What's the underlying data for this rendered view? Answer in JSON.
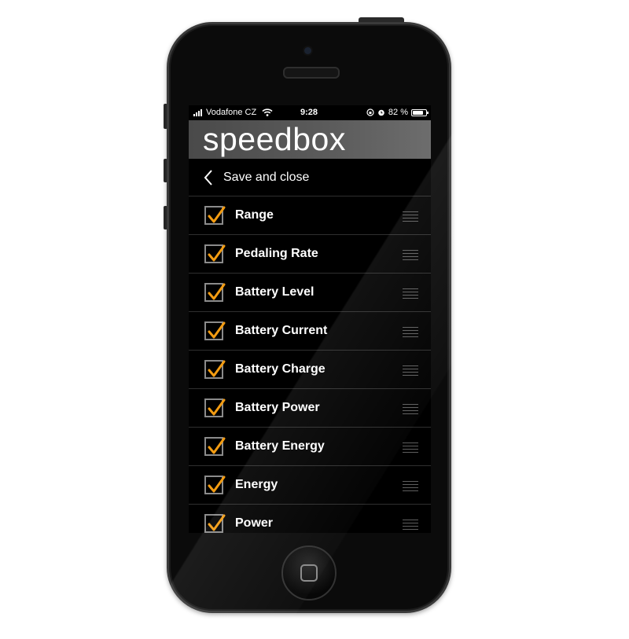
{
  "status_bar": {
    "carrier": "Vodafone CZ",
    "time": "9:28",
    "battery_percent": "82 %",
    "battery_level": 0.82
  },
  "header": {
    "logo": "speedbox"
  },
  "nav": {
    "back_icon": "chevron-left-icon",
    "title": "Save and close"
  },
  "colors": {
    "accent": "#f39c12",
    "background": "#000000",
    "header": "#555555"
  },
  "items": [
    {
      "label": "Range",
      "checked": true
    },
    {
      "label": "Pedaling Rate",
      "checked": true
    },
    {
      "label": "Battery Level",
      "checked": true
    },
    {
      "label": "Battery Current",
      "checked": true
    },
    {
      "label": "Battery Charge",
      "checked": true
    },
    {
      "label": "Battery Power",
      "checked": true
    },
    {
      "label": "Battery Energy",
      "checked": true
    },
    {
      "label": "Energy",
      "checked": true
    },
    {
      "label": "Power",
      "checked": true
    }
  ]
}
